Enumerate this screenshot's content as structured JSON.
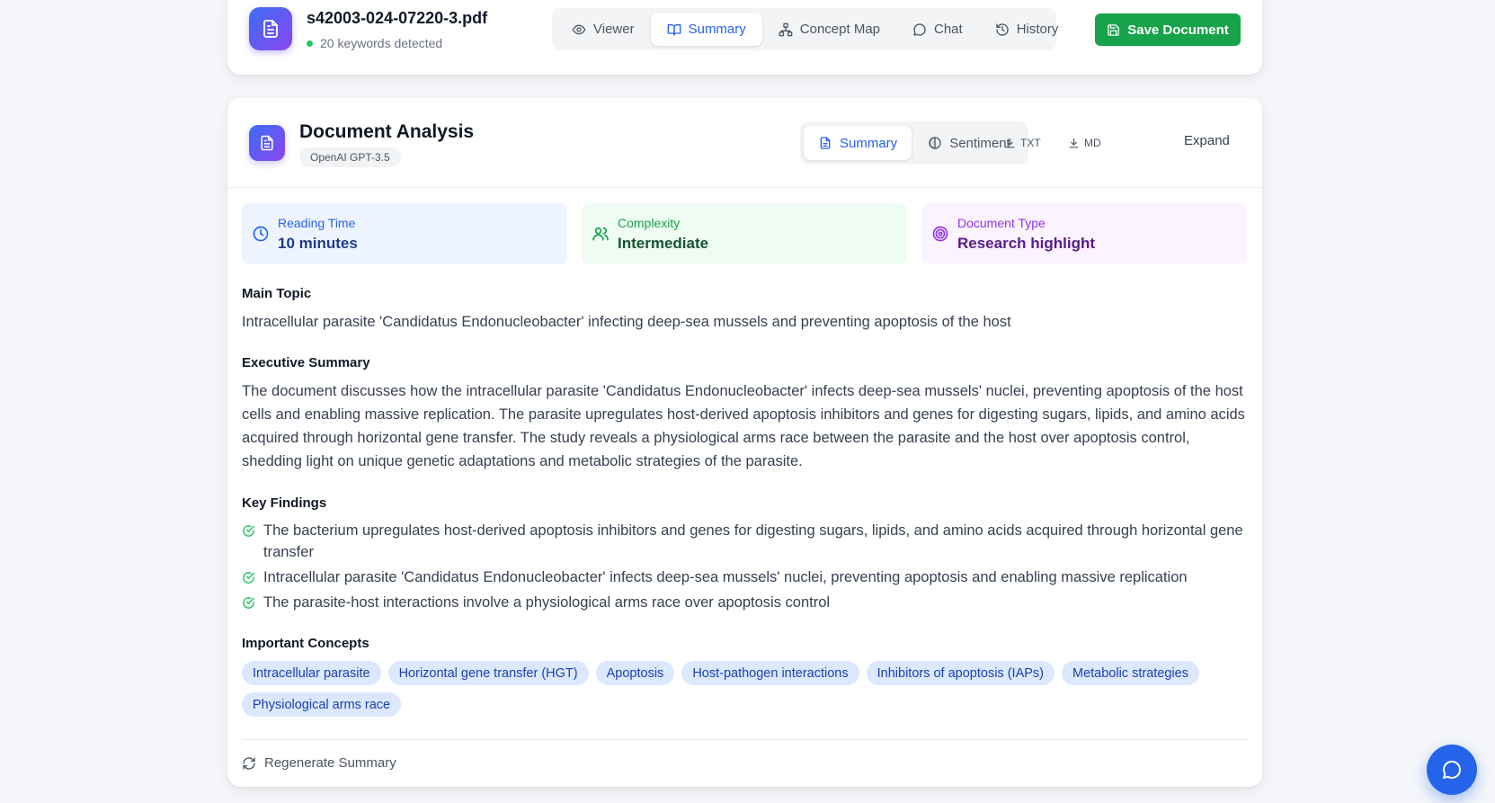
{
  "header": {
    "file_name": "s42003-024-07220-3.pdf",
    "keywords_status": "20 keywords detected",
    "tabs": [
      {
        "label": "Viewer",
        "icon": "eye-icon"
      },
      {
        "label": "Summary",
        "icon": "book-open-icon",
        "active": true
      },
      {
        "label": "Concept Map",
        "icon": "network-icon"
      },
      {
        "label": "Chat",
        "icon": "chat-bubble-icon"
      },
      {
        "label": "History",
        "icon": "history-icon"
      }
    ],
    "save_label": "Save Document"
  },
  "analysis": {
    "title": "Document Analysis",
    "model": "OpenAI GPT-3.5",
    "tabs": [
      {
        "label": "Summary",
        "icon": "document-icon",
        "active": true
      },
      {
        "label": "Sentiment",
        "icon": "half-circle-icon"
      }
    ],
    "export_txt": "TXT",
    "export_md": "MD",
    "expand_label": "Expand"
  },
  "stats": {
    "reading_time": {
      "label": "Reading Time",
      "value": "10 minutes"
    },
    "complexity": {
      "label": "Complexity",
      "value": "Intermediate"
    },
    "document_type": {
      "label": "Document Type",
      "value": "Research highlight"
    }
  },
  "main_topic": {
    "label": "Main Topic",
    "text": "Intracellular parasite 'Candidatus Endonucleobacter' infecting deep-sea mussels and preventing apoptosis of the host"
  },
  "executive_summary": {
    "label": "Executive Summary",
    "text": "The document discusses how the intracellular parasite 'Candidatus Endonucleobacter' infects deep-sea mussels' nuclei, preventing apoptosis of the host cells and enabling massive replication. The parasite upregulates host-derived apoptosis inhibitors and genes for digesting sugars, lipids, and amino acids acquired through horizontal gene transfer. The study reveals a physiological arms race between the parasite and the host over apoptosis control, shedding light on unique genetic adaptations and metabolic strategies of the parasite."
  },
  "key_findings": {
    "label": "Key Findings",
    "items": [
      "The bacterium upregulates host-derived apoptosis inhibitors and genes for digesting sugars, lipids, and amino acids acquired through horizontal gene transfer",
      "Intracellular parasite 'Candidatus Endonucleobacter' infects deep-sea mussels' nuclei, preventing apoptosis and enabling massive replication",
      "The parasite-host interactions involve a physiological arms race over apoptosis control"
    ]
  },
  "important_concepts": {
    "label": "Important Concepts",
    "items": [
      "Intracellular parasite",
      "Horizontal gene transfer (HGT)",
      "Apoptosis",
      "Host-pathogen interactions",
      "Inhibitors of apoptosis (IAPs)",
      "Metabolic strategies",
      "Physiological arms race"
    ]
  },
  "regenerate_label": "Regenerate Summary",
  "colors": {
    "accent": "#2563eb",
    "save": "#16a34a",
    "chip_bg": "#dbe8fe",
    "chip_text": "#1e40af"
  }
}
